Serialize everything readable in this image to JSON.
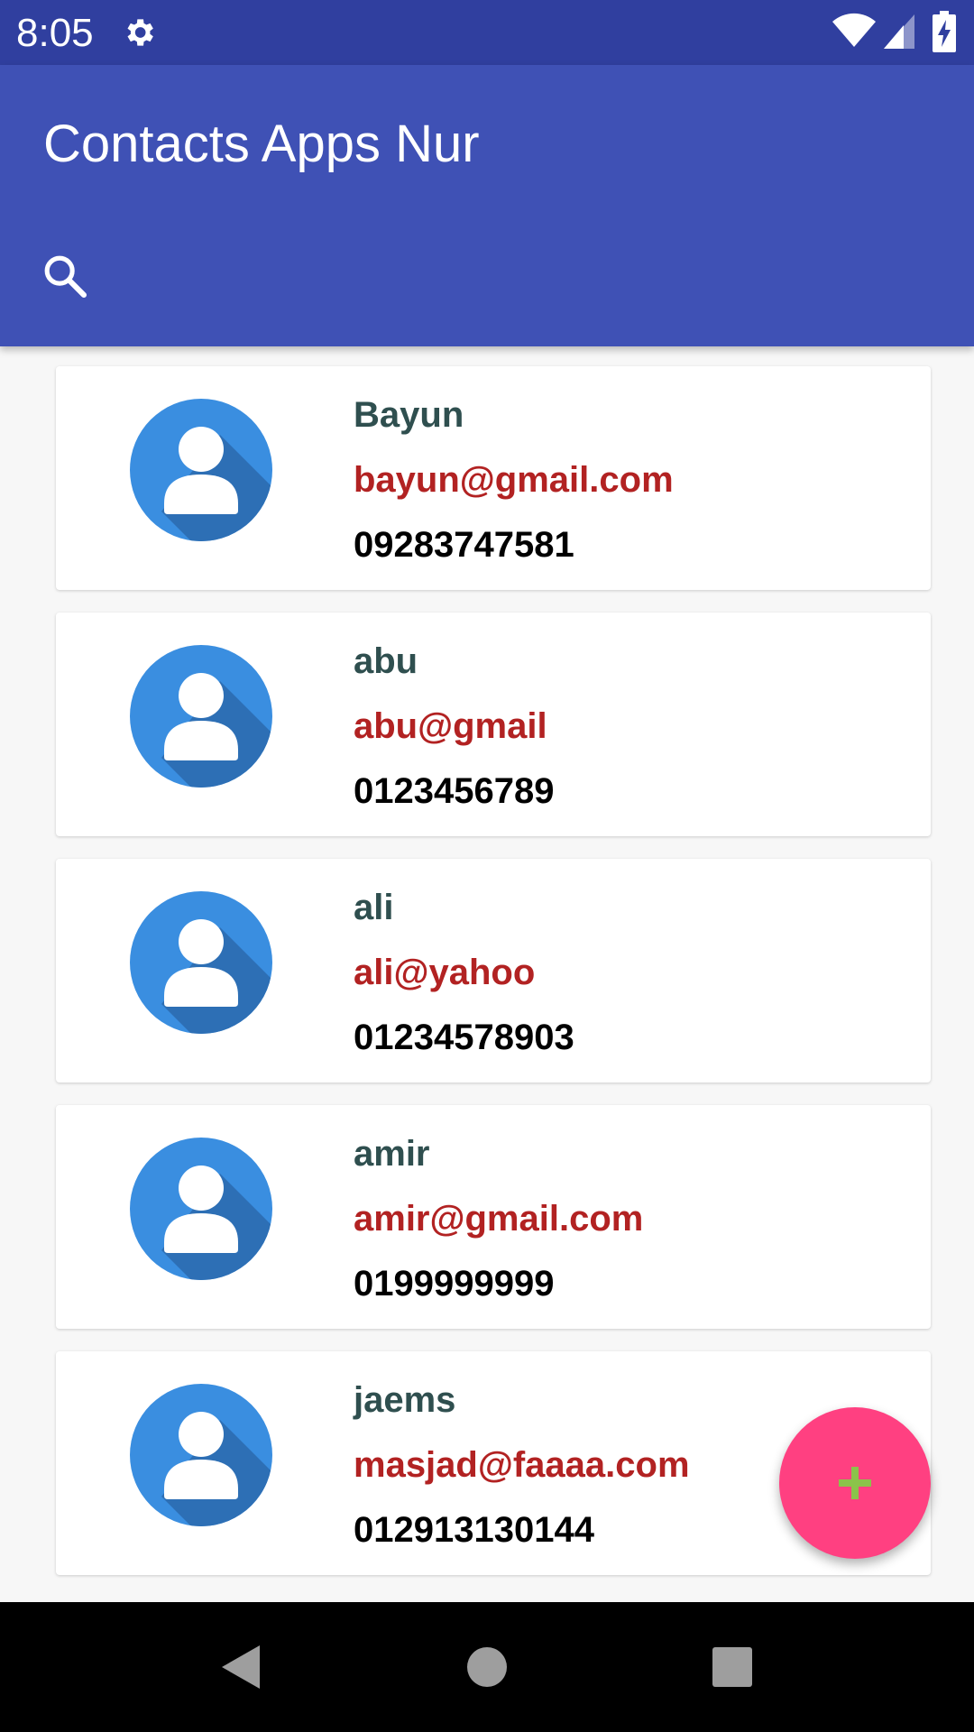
{
  "status_bar": {
    "time": "8:05",
    "icons": [
      "gear-icon",
      "wifi-icon",
      "cellular-signal-icon",
      "battery-charging-icon"
    ]
  },
  "app_bar": {
    "title": "Contacts Apps Nur",
    "search_icon": "search-icon",
    "color": "#3f51b5"
  },
  "contacts": [
    {
      "name": "Bayun",
      "email": "bayun@gmail.com",
      "phone": "09283747581"
    },
    {
      "name": "abu",
      "email": "abu@gmail",
      "phone": "0123456789"
    },
    {
      "name": "ali",
      "email": "ali@yahoo",
      "phone": "01234578903"
    },
    {
      "name": "amir",
      "email": "amir@gmail.com",
      "phone": "0199999999"
    },
    {
      "name": "jaems",
      "email": "masjad@faaaa.com",
      "phone": "012913130144"
    }
  ],
  "fab": {
    "icon": "plus-icon",
    "color": "#ff4081",
    "icon_color": "#8bc34a"
  },
  "nav_bar": {
    "icons": [
      "back-icon",
      "home-icon",
      "recents-icon"
    ]
  },
  "colors": {
    "status_bar": "#303f9f",
    "name_text": "#2f4f4f",
    "email_text": "#b22222",
    "phone_text": "#000000",
    "avatar": "#3a8ee0"
  }
}
